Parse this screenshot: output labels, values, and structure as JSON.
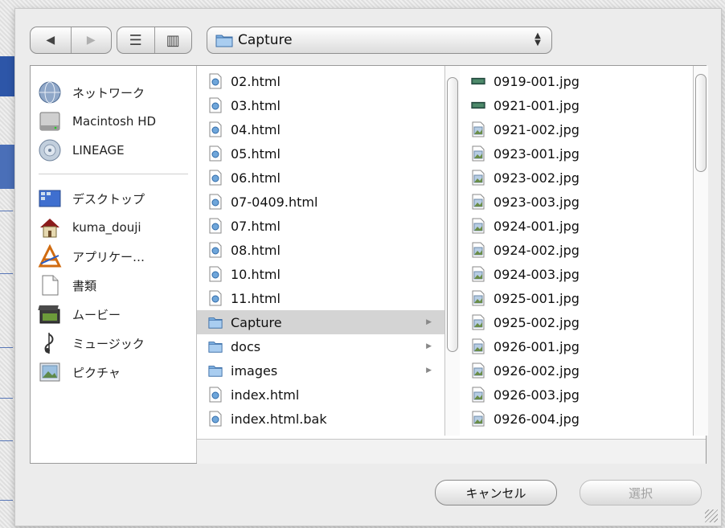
{
  "toolbar": {
    "back_glyph": "◀",
    "forward_glyph": "▶",
    "list_view_glyph": "☰",
    "column_view_glyph": "▥",
    "location": "Capture",
    "stepper_glyph": "▲▼"
  },
  "sidebar": {
    "items": [
      {
        "label": "ネットワーク",
        "icon": "network-globe-icon"
      },
      {
        "label": "Macintosh HD",
        "icon": "hard-disk-icon"
      },
      {
        "label": "LINEAGE",
        "icon": "disk-icon"
      },
      {
        "label": "デスクトップ",
        "icon": "desktop-icon"
      },
      {
        "label": "kuma_douji",
        "icon": "home-icon"
      },
      {
        "label": "アプリケー…",
        "icon": "applications-icon"
      },
      {
        "label": "書類",
        "icon": "documents-icon"
      },
      {
        "label": "ムービー",
        "icon": "movies-icon"
      },
      {
        "label": "ミュージック",
        "icon": "music-icon"
      },
      {
        "label": "ピクチャ",
        "icon": "pictures-icon"
      }
    ]
  },
  "column1": {
    "items": [
      {
        "name": "02.html",
        "kind": "html"
      },
      {
        "name": "03.html",
        "kind": "html"
      },
      {
        "name": "04.html",
        "kind": "html"
      },
      {
        "name": "05.html",
        "kind": "html"
      },
      {
        "name": "06.html",
        "kind": "html"
      },
      {
        "name": "07-0409.html",
        "kind": "html"
      },
      {
        "name": "07.html",
        "kind": "html"
      },
      {
        "name": "08.html",
        "kind": "html"
      },
      {
        "name": "10.html",
        "kind": "html"
      },
      {
        "name": "11.html",
        "kind": "html"
      },
      {
        "name": "Capture",
        "kind": "folder",
        "selected": true
      },
      {
        "name": "docs",
        "kind": "folder"
      },
      {
        "name": "images",
        "kind": "folder"
      },
      {
        "name": "index.html",
        "kind": "html"
      },
      {
        "name": "index.html.bak",
        "kind": "html"
      }
    ]
  },
  "column2": {
    "items": [
      {
        "name": "0919-001.jpg",
        "kind": "image"
      },
      {
        "name": "0921-001.jpg",
        "kind": "image"
      },
      {
        "name": "0921-002.jpg",
        "kind": "jpg"
      },
      {
        "name": "0923-001.jpg",
        "kind": "jpg"
      },
      {
        "name": "0923-002.jpg",
        "kind": "jpg"
      },
      {
        "name": "0923-003.jpg",
        "kind": "jpg"
      },
      {
        "name": "0924-001.jpg",
        "kind": "jpg"
      },
      {
        "name": "0924-002.jpg",
        "kind": "jpg"
      },
      {
        "name": "0924-003.jpg",
        "kind": "jpg"
      },
      {
        "name": "0925-001.jpg",
        "kind": "jpg"
      },
      {
        "name": "0925-002.jpg",
        "kind": "jpg"
      },
      {
        "name": "0926-001.jpg",
        "kind": "jpg"
      },
      {
        "name": "0926-002.jpg",
        "kind": "jpg"
      },
      {
        "name": "0926-003.jpg",
        "kind": "jpg"
      },
      {
        "name": "0926-004.jpg",
        "kind": "jpg"
      }
    ]
  },
  "buttons": {
    "cancel": "キャンセル",
    "choose": "選択"
  },
  "colors": {
    "selection": "#d4d4d4",
    "folder_blue": "#6ea4d8",
    "sidebar_bg": "#ffffff"
  }
}
